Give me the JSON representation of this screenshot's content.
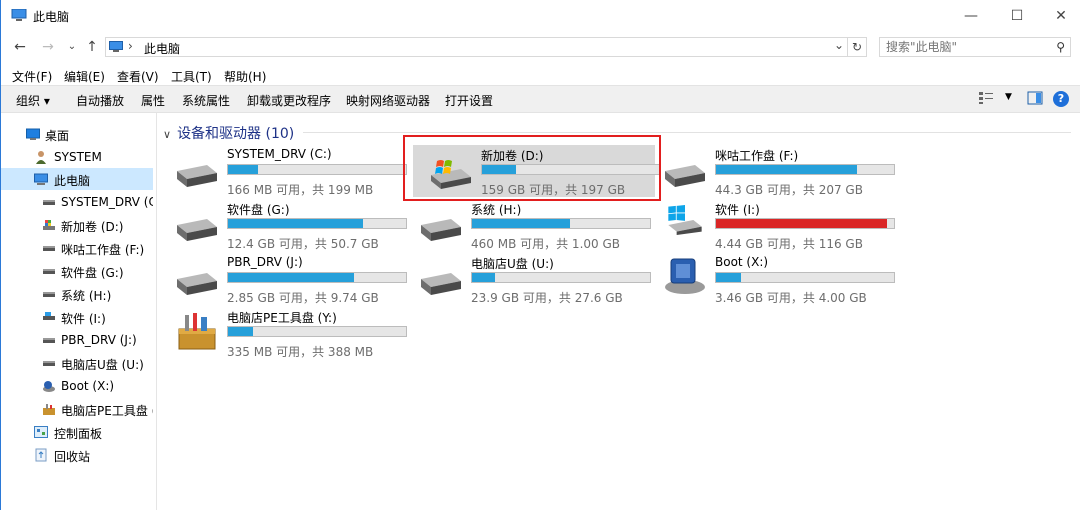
{
  "window": {
    "title": "此电脑"
  },
  "address": {
    "path": "此电脑"
  },
  "search": {
    "placeholder": "搜索\"此电脑\""
  },
  "menu": [
    "文件(F)",
    "编辑(E)",
    "查看(V)",
    "工具(T)",
    "帮助(H)"
  ],
  "commands": [
    "组织 ▾",
    "自动播放",
    "属性",
    "系统属性",
    "卸载或更改程序",
    "映射网络驱动器",
    "打开设置"
  ],
  "nav": [
    {
      "label": "桌面",
      "icon": "desktop-icon"
    },
    {
      "label": "SYSTEM",
      "icon": "user-icon"
    },
    {
      "label": "此电脑",
      "icon": "computer-icon"
    },
    {
      "label": "SYSTEM_DRV (C:",
      "icon": "drive-icon"
    },
    {
      "label": "新加卷 (D:)",
      "icon": "windows-drive-icon"
    },
    {
      "label": "咪咕工作盘 (F:)",
      "icon": "drive-icon"
    },
    {
      "label": "软件盘 (G:)",
      "icon": "drive-icon"
    },
    {
      "label": "系统 (H:)",
      "icon": "drive-icon"
    },
    {
      "label": "软件 (I:)",
      "icon": "drive-icon"
    },
    {
      "label": "PBR_DRV (J:)",
      "icon": "drive-icon"
    },
    {
      "label": "电脑店U盘 (U:)",
      "icon": "drive-icon"
    },
    {
      "label": "Boot (X:)",
      "icon": "boot-drive-icon"
    },
    {
      "label": "电脑店PE工具盘 (",
      "icon": "toolbox-icon"
    },
    {
      "label": "控制面板",
      "icon": "control-panel-icon"
    },
    {
      "label": "回收站",
      "icon": "recycle-bin-icon"
    }
  ],
  "group": {
    "title": "设备和驱动器 (10)"
  },
  "drives": [
    {
      "name": "SYSTEM_DRV (C:)",
      "free": "166 MB 可用，共 199 MB",
      "used_fraction": 0.17,
      "icon": "hdd-icon"
    },
    {
      "name": "新加卷 (D:)",
      "free": "159 GB 可用，共 197 GB",
      "used_fraction": 0.19,
      "icon": "windows-drive-icon"
    },
    {
      "name": "咪咕工作盘 (F:)",
      "free": "44.3 GB 可用，共 207 GB",
      "used_fraction": 0.79,
      "icon": "hdd-icon"
    },
    {
      "name": "软件盘 (G:)",
      "free": "12.4 GB 可用，共 50.7 GB",
      "used_fraction": 0.76,
      "icon": "hdd-icon"
    },
    {
      "name": "系统 (H:)",
      "free": "460 MB 可用，共 1.00 GB",
      "used_fraction": 0.55,
      "icon": "hdd-icon"
    },
    {
      "name": "软件 (I:)",
      "free": "4.44 GB 可用，共 116 GB",
      "used_fraction": 0.96,
      "icon": "windows-logo-drive-icon",
      "bar_color": "#da2626"
    },
    {
      "name": "PBR_DRV (J:)",
      "free": "2.85 GB 可用，共 9.74 GB",
      "used_fraction": 0.71,
      "icon": "hdd-icon"
    },
    {
      "name": "电脑店U盘 (U:)",
      "free": "23.9 GB 可用，共 27.6 GB",
      "used_fraction": 0.13,
      "icon": "hdd-icon"
    },
    {
      "name": "Boot (X:)",
      "free": "3.46 GB 可用，共 4.00 GB",
      "used_fraction": 0.14,
      "icon": "boot-drive-icon"
    },
    {
      "name": "电脑店PE工具盘 (Y:)",
      "free": "335 MB 可用，共 388 MB",
      "used_fraction": 0.14,
      "icon": "toolbox-icon"
    }
  ],
  "colors": {
    "bar": "#26a0da",
    "bar_full": "#da2626",
    "highlight": "#e21e1e",
    "selection": "#cce8ff"
  }
}
